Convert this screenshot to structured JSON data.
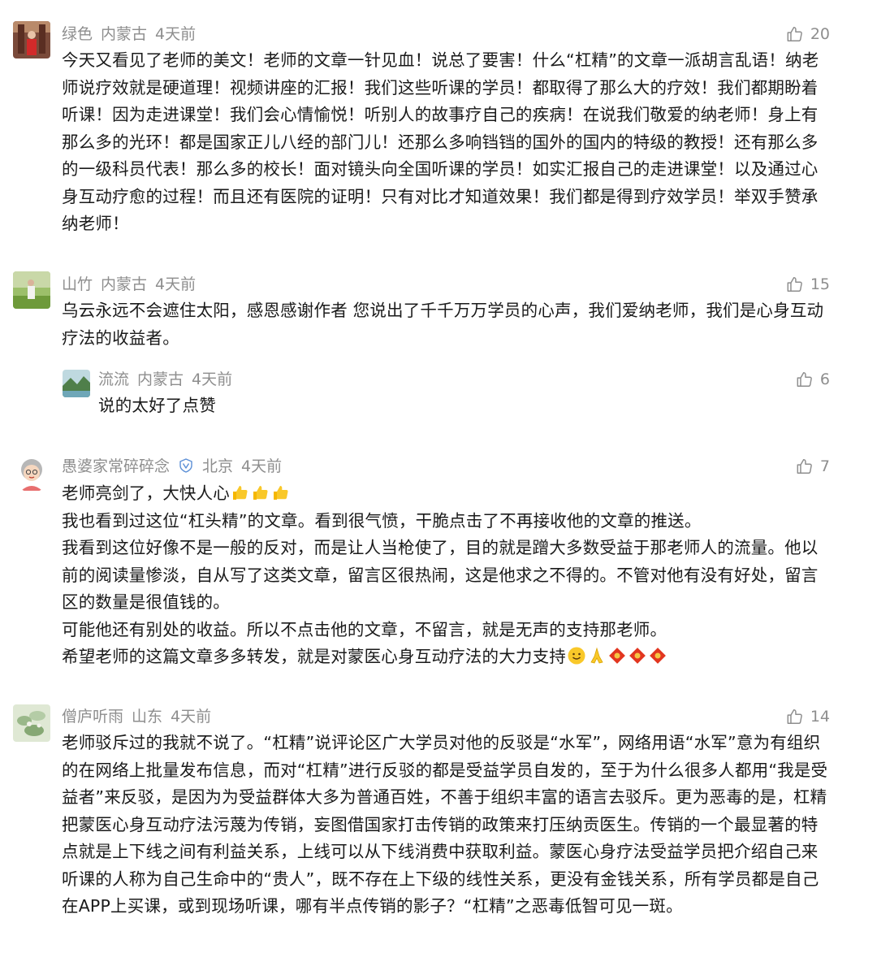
{
  "comments": [
    {
      "user": "绿色",
      "location": "内蒙古",
      "time": "4天前",
      "likes": "20",
      "text": "今天又看见了老师的美文！老师的文章一针见血！说总了要害！什么“杠精”的文章一派胡言乱语！纳老师说疗效就是硬道理！视频讲座的汇报！我们这些听课的学员！都取得了那么大的疗效！我们都期盼着听课！因为走进课堂！我们会心情愉悦！听别人的故事疗自己的疾病！在说我们敬爱的纳老师！身上有那么多的光环！都是国家正儿八经的部门儿！还那么多响铛铛的国外的国内的特级的教授！还有那么多的一级科员代表！那么多的校长！面对镜头向全国听课的学员！如实汇报自己的走进课堂！以及通过心身互动疗愈的过程！而且还有医院的证明！只有对比才知道效果！我们都是得到疗效学员！举双手赞承纳老师！"
    },
    {
      "user": "山竹",
      "location": "内蒙古",
      "time": "4天前",
      "likes": "15",
      "text": "乌云永远不会遮住太阳，感恩感谢作者 您说出了千千万万学员的心声，我们爱纳老师，我们是心身互动疗法的收益者。",
      "reply": {
        "user": "流流",
        "location": "内蒙古",
        "time": "4天前",
        "likes": "6",
        "text": "说的太好了点赞"
      }
    },
    {
      "user": "愚婆家常碎碎念",
      "location": "北京",
      "time": "4天前",
      "likes": "7",
      "paragraphs": [
        "老师亮剑了，大快人心",
        "我也看到过这位“杠头精”的文章。看到很气愤，干脆点击了不再接收他的文章的推送。",
        "我看到这位好像不是一般的反对，而是让人当枪使了，目的就是蹭大多数受益于那老师人的流量。他以前的阅读量惨淡，自从写了这类文章，留言区很热闹，这是他求之不得的。不管对他有没有好处，留言区的数量是很值钱的。",
        "可能他还有别处的收益。所以不点击他的文章，不留言，就是无声的支持那老师。",
        "希望老师的这篇文章多多转发，就是对蒙医心身互动疗法的大力支持"
      ]
    },
    {
      "user": "僧庐听雨",
      "location": "山东",
      "time": "4天前",
      "likes": "14",
      "text": "老师驳斥过的我就不说了。“杠精”说评论区广大学员对他的反驳是“水军”，网络用语“水军”意为有组织的在网络上批量发布信息，而对“杠精”进行反驳的都是受益学员自发的，至于为什么很多人都用“我是受益者”来反驳，是因为为受益群体大多为普通百姓，不善于组织丰富的语言去驳斥。更为恶毒的是，杠精把蒙医心身互动疗法污蔑为传销，妄图借国家打击传销的政策来打压纳贡医生。传销的一个最显著的特点就是上下线之间有利益关系，上线可以从下线消费中获取利益。蒙医心身疗法受益学员把介绍自己来听课的人称为自己生命中的“贵人”，既不存在上下级的线性关系，更没有金钱关系，所有学员都是自己在APP上买课，或到现场听课，哪有半点传销的影子？“杠精”之恶毒低智可见一斑。"
    }
  ],
  "colors": {
    "meta": "#8e8e8e",
    "text": "#1a1a1a",
    "verified": "#5b8fd6"
  },
  "icons": [
    "thumbs-up-icon",
    "verified-shield-icon",
    "thumbs-up-emoji",
    "smile-emoji",
    "pray-emoji",
    "fu-emoji"
  ]
}
